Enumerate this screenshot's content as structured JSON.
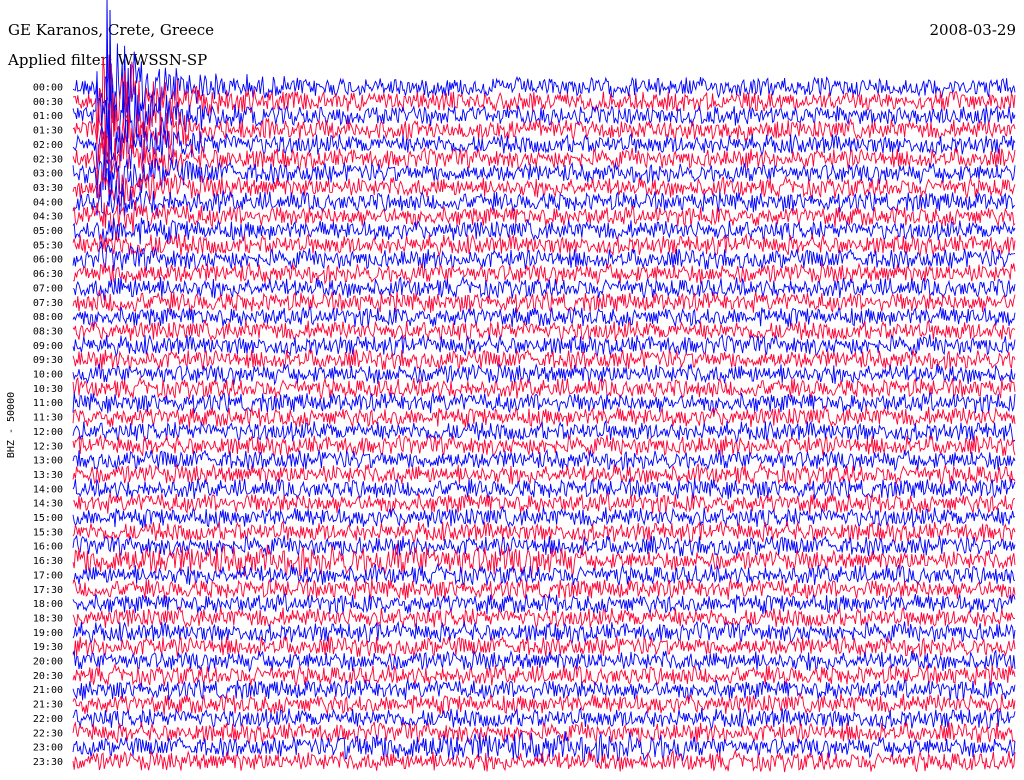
{
  "header": {
    "station": "GE Karanos, Crete, Greece",
    "date": "2008-03-29",
    "filter": "Applied filter: WWSSN-SP"
  },
  "chart_data": {
    "type": "line",
    "ylabel": "BHZ - 50000",
    "row_labels": [
      "00:00",
      "00:30",
      "01:00",
      "01:30",
      "02:00",
      "02:30",
      "03:00",
      "03:30",
      "04:00",
      "04:30",
      "05:00",
      "05:30",
      "06:00",
      "06:30",
      "07:00",
      "07:30",
      "08:00",
      "08:30",
      "09:00",
      "09:30",
      "10:00",
      "10:30",
      "11:00",
      "11:30",
      "12:00",
      "12:30",
      "13:00",
      "13:30",
      "14:00",
      "14:30",
      "15:00",
      "15:30",
      "16:00",
      "16:30",
      "17:00",
      "17:30",
      "18:00",
      "18:30",
      "19:00",
      "19:30",
      "20:00",
      "20:30",
      "21:00",
      "21:30",
      "22:00",
      "22:30",
      "23:00",
      "23:30"
    ],
    "colors": [
      "#0000ff",
      "#ff0033"
    ],
    "events": [
      {
        "row": 1,
        "x_fraction": 0.035,
        "strength": "large"
      },
      {
        "row": 33,
        "x_fraction_start": 0.0,
        "x_fraction_end": 0.54,
        "strength": "band"
      },
      {
        "row": 46,
        "x_fraction_start": 0.28,
        "x_fraction_end": 0.65,
        "strength": "band"
      }
    ]
  }
}
